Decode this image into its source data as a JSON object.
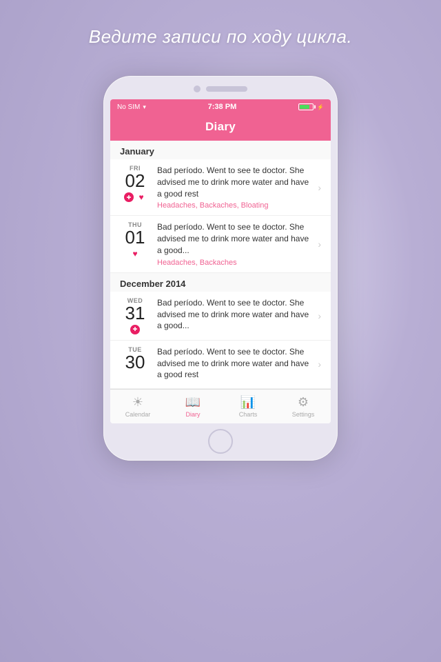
{
  "background": {
    "tagline": "Ведите записи по ходу цикла."
  },
  "status_bar": {
    "carrier": "No SIM",
    "wifi": "WiFi",
    "time": "7:38 PM",
    "battery_icon": "battery"
  },
  "header": {
    "title": "Diary"
  },
  "sections": [
    {
      "month": "January",
      "entries": [
        {
          "day_name": "FRI",
          "day_num": "02",
          "text": "Bad períodо. Went to see te doctor. She advised me to drink more water and have a good rest",
          "tags": "Headaches, Backaches, Bloating",
          "icons": [
            "period",
            "heart"
          ]
        },
        {
          "day_name": "THU",
          "day_num": "01",
          "text": "Bad períodо.\nWent to see te doctor. She advised me to drink more water and have a good...",
          "tags": "Headaches, Backaches",
          "icons": [
            "heart"
          ]
        }
      ]
    },
    {
      "month": "December 2014",
      "entries": [
        {
          "day_name": "WED",
          "day_num": "31",
          "text": "Bad  período.\nWent to see te doctor. She advised me to drink more water and have a good...",
          "tags": "",
          "icons": [
            "period"
          ]
        },
        {
          "day_name": "TUE",
          "day_num": "30",
          "text": "Bad períodо. Went to see te doctor. She advised me to drink more water and have a good rest",
          "tags": "",
          "icons": []
        }
      ]
    }
  ],
  "tabs": [
    {
      "id": "calendar",
      "label": "Calendar",
      "icon": "☀",
      "active": false
    },
    {
      "id": "diary",
      "label": "Diary",
      "icon": "📖",
      "active": true
    },
    {
      "id": "charts",
      "label": "Charts",
      "icon": "📊",
      "active": false
    },
    {
      "id": "settings",
      "label": "Settings",
      "icon": "⚙",
      "active": false
    }
  ]
}
